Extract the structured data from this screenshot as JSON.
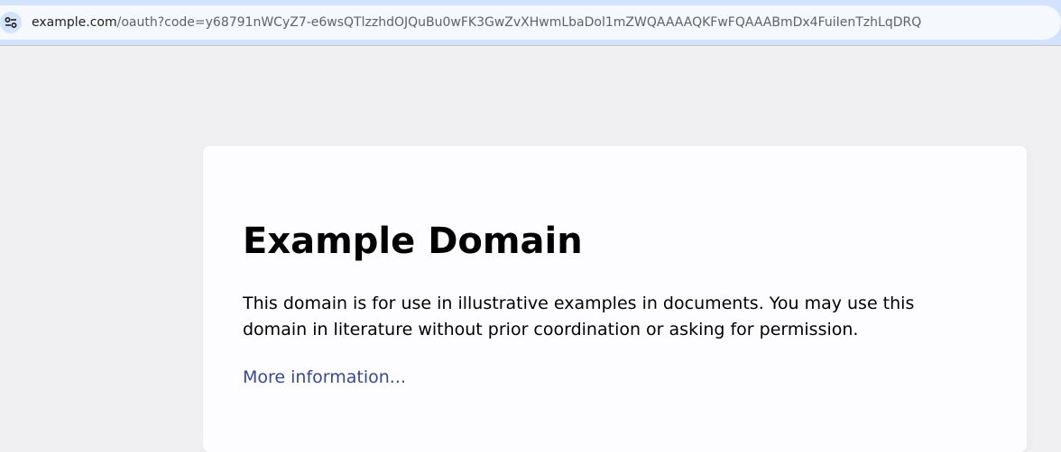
{
  "browser": {
    "url_host": "example.com",
    "url_rest": "/oauth?code=y68791nWCyZ7-e6wsQTlzzhdOJQuBu0wFK3GwZvXHwmLbaDol1mZWQAAAAQKFwFQAAABmDx4FuiIenTzhLqDRQ",
    "site_info_icon": "tune-icon"
  },
  "page": {
    "heading": "Example Domain",
    "description": "This domain is for use in illustrative examples in documents. You may use this domain in literature without prior coordination or asking for permission.",
    "link_text": "More information..."
  },
  "colors": {
    "toolbar": "#d3e3fd",
    "page_background": "#f0f0f2",
    "card_background": "#fdfdff",
    "link": "#38488f"
  }
}
